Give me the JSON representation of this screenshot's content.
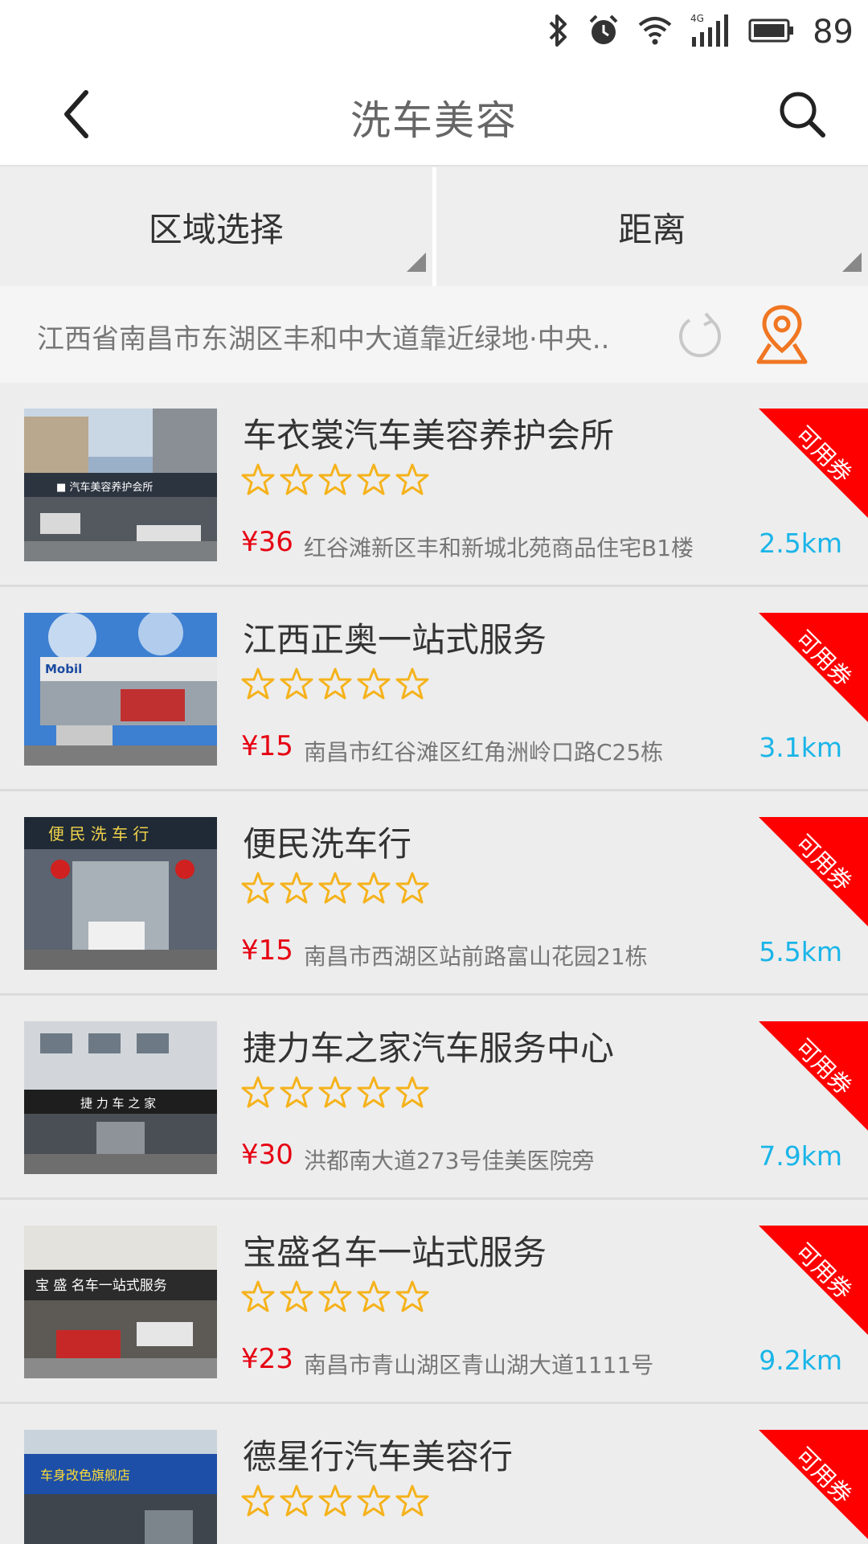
{
  "status_bar": {
    "battery_level": "89",
    "network": "4G",
    "icons": [
      "bluetooth-icon",
      "alarm-icon",
      "wifi-icon",
      "signal-icon",
      "battery-icon"
    ]
  },
  "header": {
    "title": "洗车美容",
    "back_icon": "chevron-left-icon",
    "search_icon": "search-icon"
  },
  "filters": {
    "region_label": "区域选择",
    "distance_label": "距离"
  },
  "location": {
    "address": "江西省南昌市东湖区丰和中大道靠近绿地·中央..",
    "refresh_icon": "refresh-icon",
    "pin_icon": "map-pin-icon"
  },
  "colors": {
    "price": "#e60012",
    "distance": "#1ab5e8",
    "coupon": "#ff0000",
    "star": "#f5b21b",
    "pin": "#f07622"
  },
  "shops": [
    {
      "name": "车衣裳汽车美容养护会所",
      "rating": 5,
      "price": "¥36",
      "address": "红谷滩新区丰和新城北苑商品住宅B1楼",
      "distance": "2.5km",
      "coupon": "可用券"
    },
    {
      "name": "江西正奥一站式服务",
      "rating": 5,
      "price": "¥15",
      "address": "南昌市红谷滩区红角洲岭口路C25栋",
      "distance": "3.1km",
      "coupon": "可用券"
    },
    {
      "name": "便民洗车行",
      "rating": 5,
      "price": "¥15",
      "address": "南昌市西湖区站前路富山花园21栋",
      "distance": "5.5km",
      "coupon": "可用券"
    },
    {
      "name": "捷力车之家汽车服务中心",
      "rating": 5,
      "price": "¥30",
      "address": "洪都南大道273号佳美医院旁",
      "distance": "7.9km",
      "coupon": "可用券"
    },
    {
      "name": "宝盛名车一站式服务",
      "rating": 5,
      "price": "¥23",
      "address": "南昌市青山湖区青山湖大道1111号",
      "distance": "9.2km",
      "coupon": "可用券"
    },
    {
      "name": "德星行汽车美容行",
      "rating": 5,
      "price": "",
      "address": "",
      "distance": "",
      "coupon": "可用券"
    }
  ]
}
